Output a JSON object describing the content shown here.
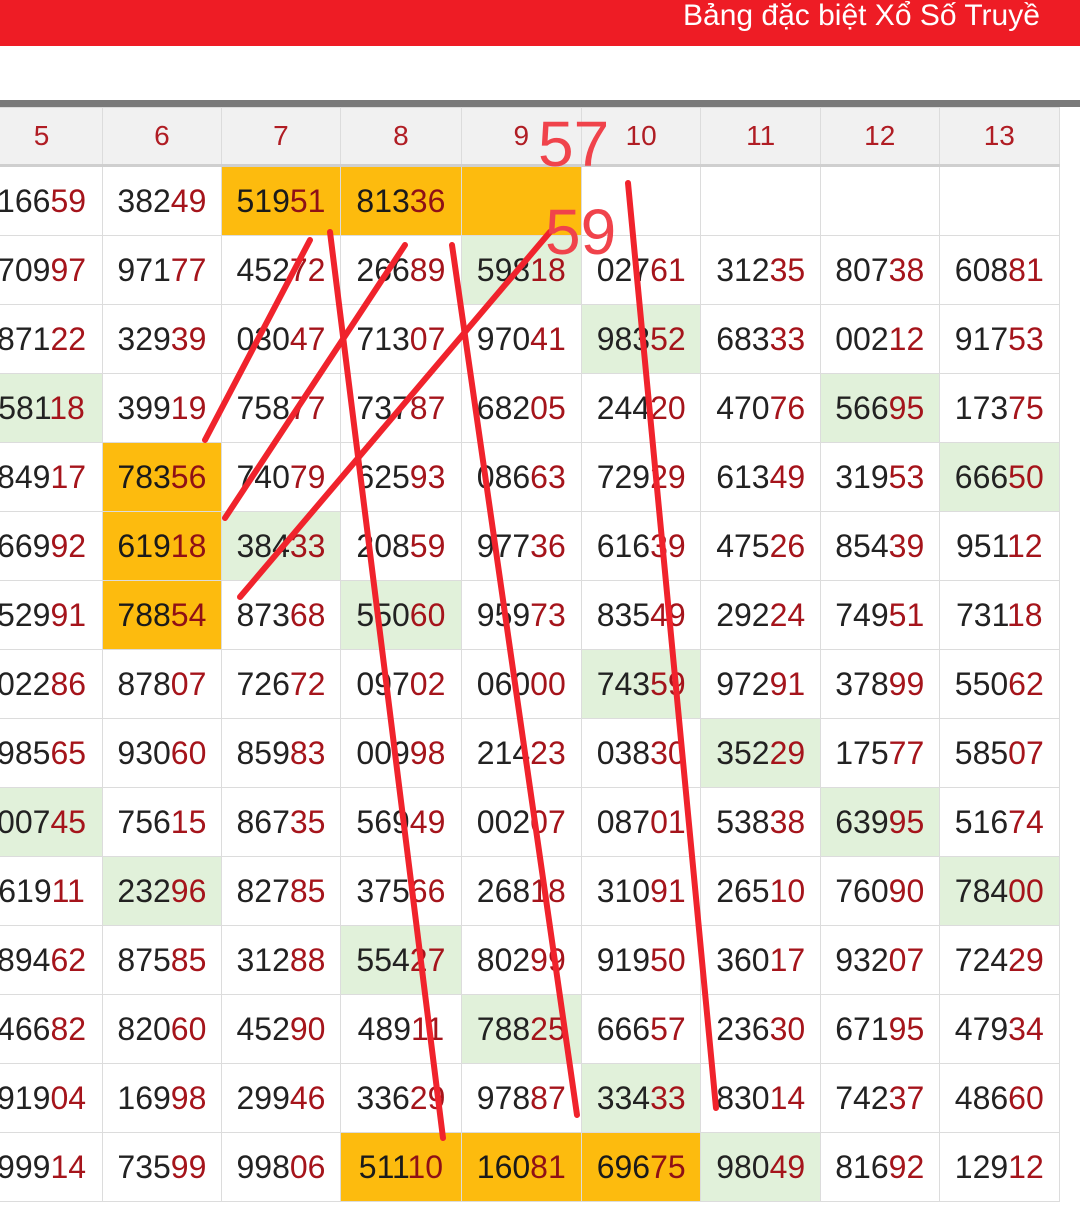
{
  "header": {
    "title": "Bảng đặc biệt Xổ Số Truyề",
    "accent_color": "#ee1c25"
  },
  "table": {
    "columns": [
      "5",
      "6",
      "7",
      "8",
      "9",
      "10",
      "11",
      "12",
      "13"
    ],
    "rows": [
      [
        [
          "166",
          "59"
        ],
        [
          "382",
          "49"
        ],
        [
          "519",
          "51"
        ],
        [
          "813",
          "36"
        ],
        [
          "",
          ""
        ],
        [
          "",
          ""
        ],
        [
          "",
          ""
        ],
        [
          "",
          ""
        ],
        [
          "",
          ""
        ]
      ],
      [
        [
          "709",
          "97"
        ],
        [
          "971",
          "77"
        ],
        [
          "452",
          "72"
        ],
        [
          "266",
          "89"
        ],
        [
          "598",
          "18"
        ],
        [
          "027",
          "61"
        ],
        [
          "312",
          "35"
        ],
        [
          "807",
          "38"
        ],
        [
          "608",
          "81"
        ]
      ],
      [
        [
          "871",
          "22"
        ],
        [
          "329",
          "39"
        ],
        [
          "030",
          "47"
        ],
        [
          "713",
          "07"
        ],
        [
          "970",
          "41"
        ],
        [
          "983",
          "52"
        ],
        [
          "683",
          "33"
        ],
        [
          "002",
          "12"
        ],
        [
          "917",
          "53"
        ]
      ],
      [
        [
          "581",
          "18"
        ],
        [
          "399",
          "19"
        ],
        [
          "758",
          "77"
        ],
        [
          "737",
          "87"
        ],
        [
          "682",
          "05"
        ],
        [
          "244",
          "20"
        ],
        [
          "470",
          "76"
        ],
        [
          "566",
          "95"
        ],
        [
          "173",
          "75"
        ]
      ],
      [
        [
          "849",
          "17"
        ],
        [
          "783",
          "56"
        ],
        [
          "740",
          "79"
        ],
        [
          "625",
          "93"
        ],
        [
          "086",
          "63"
        ],
        [
          "729",
          "29"
        ],
        [
          "613",
          "49"
        ],
        [
          "319",
          "53"
        ],
        [
          "666",
          "50"
        ]
      ],
      [
        [
          "669",
          "92"
        ],
        [
          "619",
          "18"
        ],
        [
          "384",
          "33"
        ],
        [
          "208",
          "59"
        ],
        [
          "977",
          "36"
        ],
        [
          "616",
          "39"
        ],
        [
          "475",
          "26"
        ],
        [
          "854",
          "39"
        ],
        [
          "951",
          "12"
        ]
      ],
      [
        [
          "529",
          "91"
        ],
        [
          "788",
          "54"
        ],
        [
          "873",
          "68"
        ],
        [
          "550",
          "60"
        ],
        [
          "959",
          "73"
        ],
        [
          "835",
          "49"
        ],
        [
          "292",
          "24"
        ],
        [
          "749",
          "51"
        ],
        [
          "731",
          "18"
        ]
      ],
      [
        [
          "022",
          "86"
        ],
        [
          "878",
          "07"
        ],
        [
          "726",
          "72"
        ],
        [
          "097",
          "02"
        ],
        [
          "060",
          "00"
        ],
        [
          "743",
          "59"
        ],
        [
          "972",
          "91"
        ],
        [
          "378",
          "99"
        ],
        [
          "550",
          "62"
        ]
      ],
      [
        [
          "985",
          "65"
        ],
        [
          "930",
          "60"
        ],
        [
          "859",
          "83"
        ],
        [
          "009",
          "98"
        ],
        [
          "214",
          "23"
        ],
        [
          "038",
          "30"
        ],
        [
          "352",
          "29"
        ],
        [
          "175",
          "77"
        ],
        [
          "585",
          "07"
        ]
      ],
      [
        [
          "007",
          "45"
        ],
        [
          "756",
          "15"
        ],
        [
          "867",
          "35"
        ],
        [
          "569",
          "49"
        ],
        [
          "002",
          "07"
        ],
        [
          "087",
          "01"
        ],
        [
          "538",
          "38"
        ],
        [
          "639",
          "95"
        ],
        [
          "516",
          "74"
        ]
      ],
      [
        [
          "619",
          "11"
        ],
        [
          "232",
          "96"
        ],
        [
          "827",
          "85"
        ],
        [
          "375",
          "66"
        ],
        [
          "268",
          "18"
        ],
        [
          "310",
          "91"
        ],
        [
          "265",
          "10"
        ],
        [
          "760",
          "90"
        ],
        [
          "784",
          "00"
        ]
      ],
      [
        [
          "894",
          "62"
        ],
        [
          "875",
          "85"
        ],
        [
          "312",
          "88"
        ],
        [
          "554",
          "27"
        ],
        [
          "802",
          "99"
        ],
        [
          "919",
          "50"
        ],
        [
          "360",
          "17"
        ],
        [
          "932",
          "07"
        ],
        [
          "724",
          "29"
        ]
      ],
      [
        [
          "466",
          "82"
        ],
        [
          "820",
          "60"
        ],
        [
          "452",
          "90"
        ],
        [
          "489",
          "11"
        ],
        [
          "788",
          "25"
        ],
        [
          "666",
          "57"
        ],
        [
          "236",
          "30"
        ],
        [
          "671",
          "95"
        ],
        [
          "479",
          "34"
        ]
      ],
      [
        [
          "919",
          "04"
        ],
        [
          "169",
          "98"
        ],
        [
          "299",
          "46"
        ],
        [
          "336",
          "29"
        ],
        [
          "978",
          "87"
        ],
        [
          "334",
          "33"
        ],
        [
          "830",
          "14"
        ],
        [
          "742",
          "37"
        ],
        [
          "486",
          "60"
        ]
      ],
      [
        [
          "999",
          "14"
        ],
        [
          "735",
          "99"
        ],
        [
          "998",
          "06"
        ],
        [
          "511",
          "10"
        ],
        [
          "160",
          "81"
        ],
        [
          "696",
          "75"
        ],
        [
          "980",
          "49"
        ],
        [
          "816",
          "92"
        ],
        [
          "129",
          "12"
        ]
      ]
    ],
    "highlights": {
      "orange": [
        [
          0,
          2
        ],
        [
          0,
          3
        ],
        [
          0,
          4
        ],
        [
          4,
          1
        ],
        [
          5,
          1
        ],
        [
          6,
          1
        ],
        [
          14,
          3
        ],
        [
          14,
          4
        ],
        [
          14,
          5
        ]
      ],
      "green": [
        [
          1,
          4
        ],
        [
          2,
          5
        ],
        [
          3,
          0
        ],
        [
          3,
          7
        ],
        [
          4,
          8
        ],
        [
          5,
          2
        ],
        [
          6,
          3
        ],
        [
          7,
          5
        ],
        [
          8,
          6
        ],
        [
          9,
          0
        ],
        [
          9,
          7
        ],
        [
          10,
          1
        ],
        [
          10,
          8
        ],
        [
          11,
          3
        ],
        [
          12,
          4
        ],
        [
          13,
          5
        ],
        [
          14,
          6
        ]
      ]
    },
    "highlight_colors": {
      "orange": "#fdbb0e",
      "green": "#e1f1da"
    }
  },
  "annotations": {
    "labels": [
      "57",
      "59"
    ],
    "stroke_color": "#f0232c"
  }
}
